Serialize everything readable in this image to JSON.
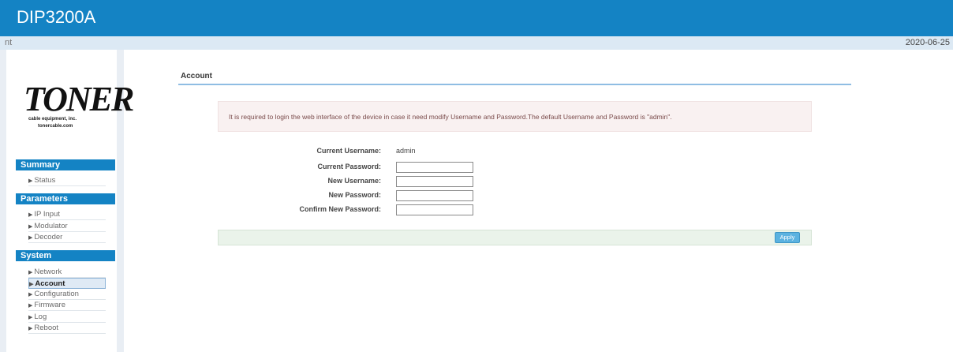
{
  "header": {
    "title": "DIP3200A"
  },
  "subbar": {
    "left_text": "nt",
    "date": "2020-06-25"
  },
  "logo": {
    "brand": "TONER",
    "tagline1": "cable equipment, inc.",
    "tagline2": "tonercable.com"
  },
  "sidebar": {
    "sections": [
      {
        "label": "Summary",
        "items": [
          "Status"
        ]
      },
      {
        "label": "Parameters",
        "items": [
          "IP Input",
          "Modulator",
          "Decoder"
        ]
      },
      {
        "label": "System",
        "items": [
          "Network",
          "Account",
          "Configuration",
          "Firmware",
          "Log",
          "Reboot"
        ]
      }
    ],
    "active_item": "Account"
  },
  "main": {
    "title": "Account",
    "notice": "It is required to login the web interface of the device in case it need modify Username and Password.The default Username and Password is \"admin\".",
    "form": {
      "current_username_label": "Current Username:",
      "current_username_value": "admin",
      "current_password_label": "Current Password:",
      "new_username_label": "New Username:",
      "new_password_label": "New Password:",
      "confirm_password_label": "Confirm New Password:"
    },
    "apply_label": "Apply"
  }
}
